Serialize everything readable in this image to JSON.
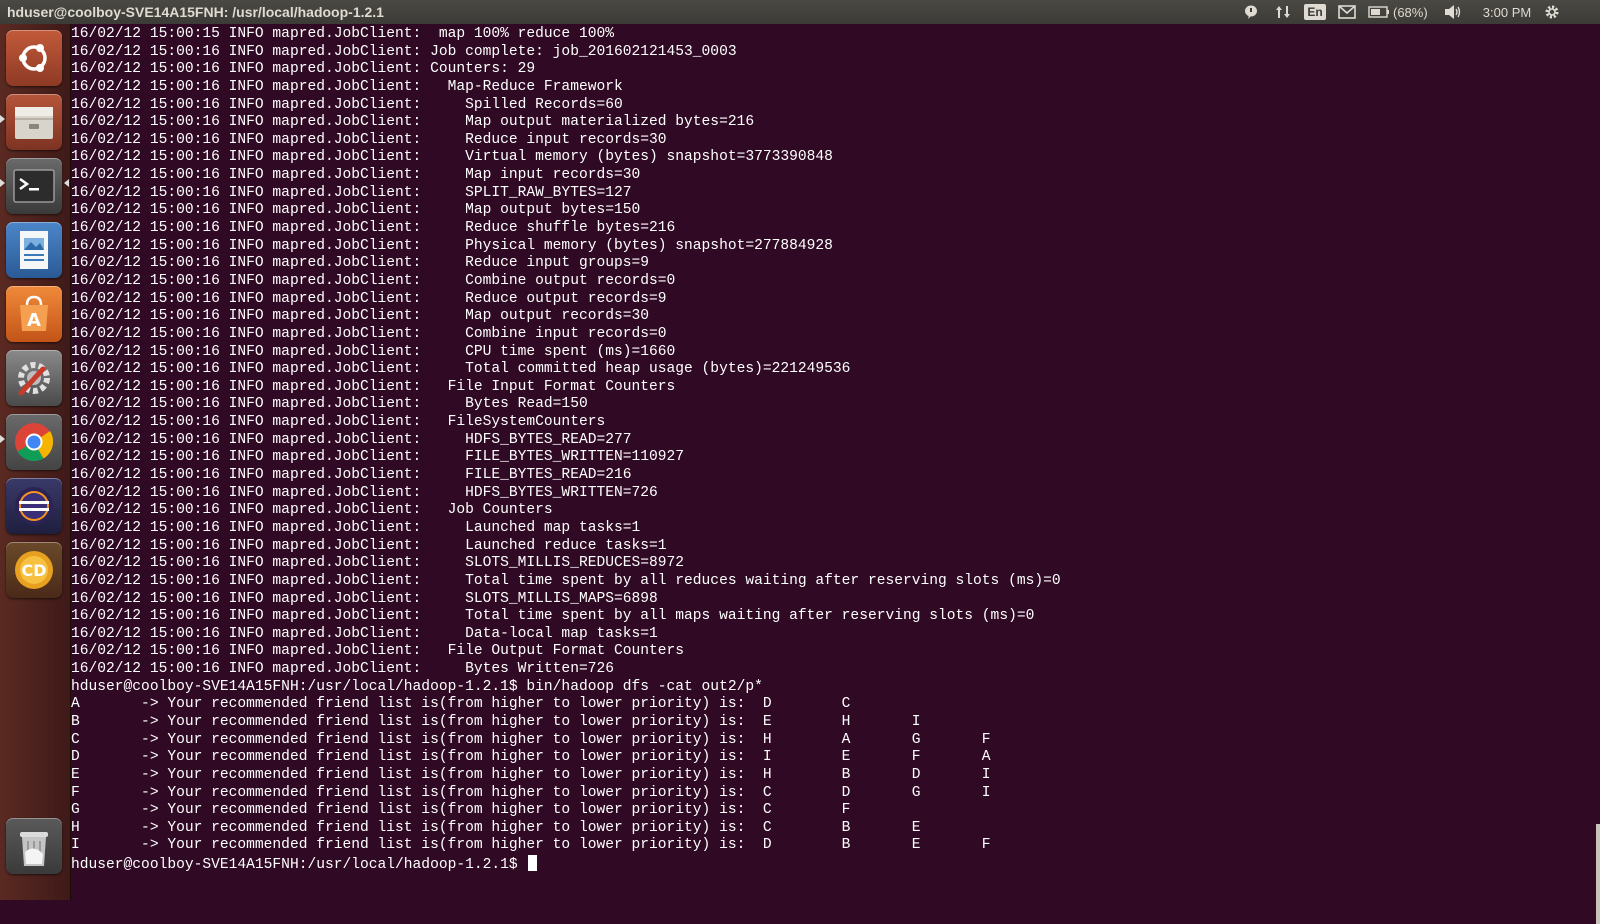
{
  "window": {
    "title": "hduser@coolboy-SVE14A15FNH: /usr/local/hadoop-1.2.1"
  },
  "indicators": {
    "keyboard_layout": "En",
    "battery": "(68%)",
    "clock": "3:00 PM",
    "icons": [
      "messaging-bubble-icon",
      "network-arrows-icon",
      "keyboard-layout-icon",
      "mail-icon",
      "battery-icon",
      "volume-icon",
      "session-gear-icon"
    ]
  },
  "launcher": {
    "items": [
      "dash-home-icon",
      "files-icon",
      "terminal-icon",
      "libreoffice-writer-icon",
      "software-center-icon",
      "system-settings-icon",
      "chrome-icon",
      "eclipse-icon",
      "cd-burner-icon",
      "trash-icon"
    ]
  },
  "terminal": {
    "lines": [
      "16/02/12 15:00:15 INFO mapred.JobClient:  map 100% reduce 100%",
      "16/02/12 15:00:16 INFO mapred.JobClient: Job complete: job_201602121453_0003",
      "16/02/12 15:00:16 INFO mapred.JobClient: Counters: 29",
      "16/02/12 15:00:16 INFO mapred.JobClient:   Map-Reduce Framework",
      "16/02/12 15:00:16 INFO mapred.JobClient:     Spilled Records=60",
      "16/02/12 15:00:16 INFO mapred.JobClient:     Map output materialized bytes=216",
      "16/02/12 15:00:16 INFO mapred.JobClient:     Reduce input records=30",
      "16/02/12 15:00:16 INFO mapred.JobClient:     Virtual memory (bytes) snapshot=3773390848",
      "16/02/12 15:00:16 INFO mapred.JobClient:     Map input records=30",
      "16/02/12 15:00:16 INFO mapred.JobClient:     SPLIT_RAW_BYTES=127",
      "16/02/12 15:00:16 INFO mapred.JobClient:     Map output bytes=150",
      "16/02/12 15:00:16 INFO mapred.JobClient:     Reduce shuffle bytes=216",
      "16/02/12 15:00:16 INFO mapred.JobClient:     Physical memory (bytes) snapshot=277884928",
      "16/02/12 15:00:16 INFO mapred.JobClient:     Reduce input groups=9",
      "16/02/12 15:00:16 INFO mapred.JobClient:     Combine output records=0",
      "16/02/12 15:00:16 INFO mapred.JobClient:     Reduce output records=9",
      "16/02/12 15:00:16 INFO mapred.JobClient:     Map output records=30",
      "16/02/12 15:00:16 INFO mapred.JobClient:     Combine input records=0",
      "16/02/12 15:00:16 INFO mapred.JobClient:     CPU time spent (ms)=1660",
      "16/02/12 15:00:16 INFO mapred.JobClient:     Total committed heap usage (bytes)=221249536",
      "16/02/12 15:00:16 INFO mapred.JobClient:   File Input Format Counters",
      "16/02/12 15:00:16 INFO mapred.JobClient:     Bytes Read=150",
      "16/02/12 15:00:16 INFO mapred.JobClient:   FileSystemCounters",
      "16/02/12 15:00:16 INFO mapred.JobClient:     HDFS_BYTES_READ=277",
      "16/02/12 15:00:16 INFO mapred.JobClient:     FILE_BYTES_WRITTEN=110927",
      "16/02/12 15:00:16 INFO mapred.JobClient:     FILE_BYTES_READ=216",
      "16/02/12 15:00:16 INFO mapred.JobClient:     HDFS_BYTES_WRITTEN=726",
      "16/02/12 15:00:16 INFO mapred.JobClient:   Job Counters",
      "16/02/12 15:00:16 INFO mapred.JobClient:     Launched map tasks=1",
      "16/02/12 15:00:16 INFO mapred.JobClient:     Launched reduce tasks=1",
      "16/02/12 15:00:16 INFO mapred.JobClient:     SLOTS_MILLIS_REDUCES=8972",
      "16/02/12 15:00:16 INFO mapred.JobClient:     Total time spent by all reduces waiting after reserving slots (ms)=0",
      "16/02/12 15:00:16 INFO mapred.JobClient:     SLOTS_MILLIS_MAPS=6898",
      "16/02/12 15:00:16 INFO mapred.JobClient:     Total time spent by all maps waiting after reserving slots (ms)=0",
      "16/02/12 15:00:16 INFO mapred.JobClient:     Data-local map tasks=1",
      "16/02/12 15:00:16 INFO mapred.JobClient:   File Output Format Counters",
      "16/02/12 15:00:16 INFO mapred.JobClient:     Bytes Written=726",
      "hduser@coolboy-SVE14A15FNH:/usr/local/hadoop-1.2.1$ bin/hadoop dfs -cat out2/p*",
      "A       -> Your recommended friend list is(from higher to lower priority) is:  D        C",
      "B       -> Your recommended friend list is(from higher to lower priority) is:  E        H       I",
      "C       -> Your recommended friend list is(from higher to lower priority) is:  H        A       G       F",
      "D       -> Your recommended friend list is(from higher to lower priority) is:  I        E       F       A",
      "E       -> Your recommended friend list is(from higher to lower priority) is:  H        B       D       I",
      "F       -> Your recommended friend list is(from higher to lower priority) is:  C        D       G       I",
      "G       -> Your recommended friend list is(from higher to lower priority) is:  C        F",
      "H       -> Your recommended friend list is(from higher to lower priority) is:  C        B       E",
      "I       -> Your recommended friend list is(from higher to lower priority) is:  D        B       E       F"
    ],
    "prompt": "hduser@coolboy-SVE14A15FNH:/usr/local/hadoop-1.2.1$ "
  }
}
